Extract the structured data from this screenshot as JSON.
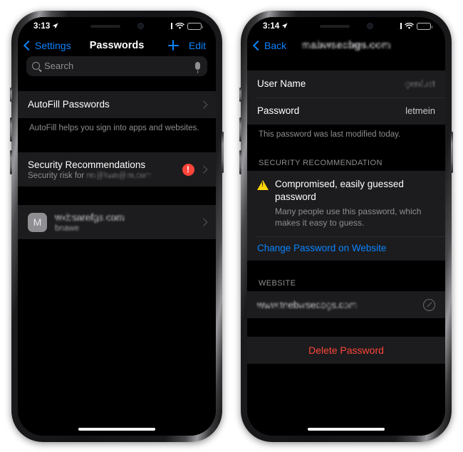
{
  "phones": [
    {
      "id": "passwords-list",
      "status_bar": {
        "time": "3:13",
        "location_icon": "location-arrow-icon",
        "cellular_icon": "cellular-bars-icon",
        "wifi_icon": "wifi-icon",
        "battery_icon": "battery-icon"
      },
      "nav": {
        "back_label": "Settings",
        "title": "Passwords",
        "add_icon": "plus-icon",
        "edit_label": "Edit"
      },
      "search": {
        "placeholder": "Search",
        "search_icon": "search-icon",
        "dictation_icon": "microphone-icon"
      },
      "autofill": {
        "title": "AutoFill Passwords",
        "footer": "AutoFill helps you sign into apps and websites."
      },
      "security": {
        "title": "Security Recommendations",
        "subtitle_prefix": "Security risk for ",
        "subtitle_site_redacted": "nn@kwn@m.com",
        "badge": "!"
      },
      "account": {
        "avatar_letter": "M",
        "site_redacted": "wxbsarefgs.com",
        "user_redacted": "bnawe"
      }
    },
    {
      "id": "password-detail",
      "status_bar": {
        "time": "3:14",
        "location_icon": "location-arrow-icon",
        "cellular_icon": "cellular-bars-icon",
        "wifi_icon": "wifi-icon",
        "battery_icon": "battery-icon"
      },
      "nav": {
        "back_label": "Back",
        "title_redacted": "mabwsecbgs.com"
      },
      "fields": {
        "username_label": "User Name",
        "username_value_redacted": "genfust",
        "password_label": "Password",
        "password_value": "letmein",
        "modified_footer": "This password was last modified today."
      },
      "recommendation": {
        "section_header": "SECURITY RECOMMENDATION",
        "warning_icon": "warning-triangle-icon",
        "title": "Compromised, easily guessed password",
        "description": "Many people use this password, which makes it easy to guess.",
        "link_label": "Change Password on Website"
      },
      "website": {
        "section_header": "WEBSITE",
        "url_redacted": "www.tnebwsecbgs.com",
        "open_icon": "safari-compass-icon"
      },
      "delete": {
        "label": "Delete Password"
      }
    }
  ],
  "colors": {
    "accent_blue": "#0a84ff",
    "destructive_red": "#ff453a",
    "warning_yellow": "#ffd60a",
    "row_background": "#1c1c1e",
    "secondary_text": "#8e8e93"
  }
}
